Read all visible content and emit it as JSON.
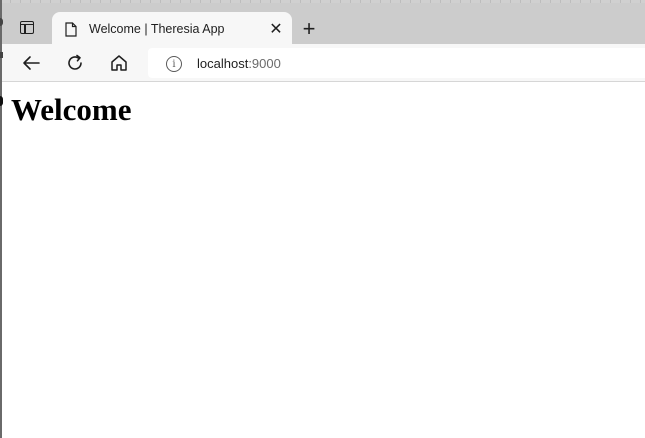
{
  "browser": {
    "tab": {
      "title": "Welcome | Theresia App",
      "close_symbol": "✕"
    },
    "new_tab_symbol": "+",
    "address_bar": {
      "host": "localhost",
      "port": ":9000"
    },
    "icons": {
      "vertical_tabs": "vertical-tabs-icon",
      "page": "page-icon",
      "back": "arrow-left-icon",
      "reload": "reload-icon",
      "home": "home-icon",
      "info": "info-icon"
    }
  },
  "page": {
    "heading": "Welcome"
  }
}
